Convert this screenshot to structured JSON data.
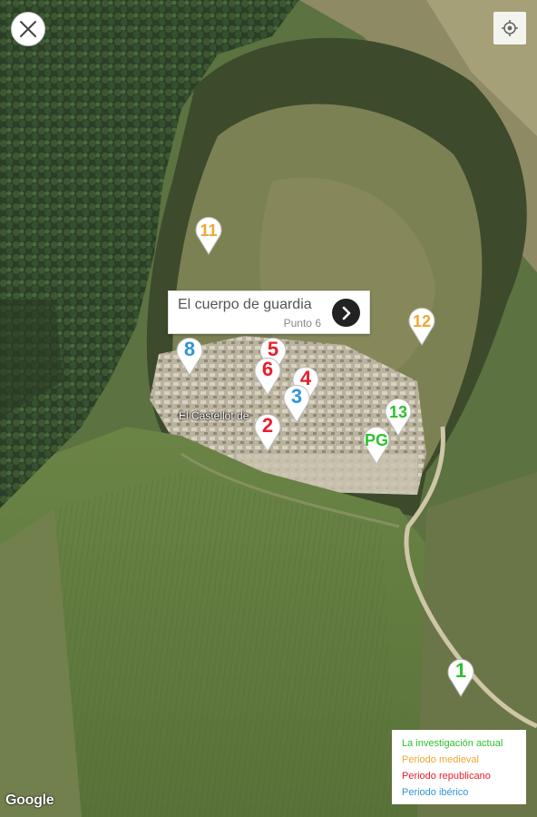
{
  "map": {
    "type": "satellite",
    "attribution": "Google",
    "site_label": "El Castellot de "
  },
  "controls": {
    "close_icon": "close-icon",
    "locate_icon": "locate-icon"
  },
  "callout": {
    "title": "El cuerpo de guardia",
    "subtitle": "Punto 6",
    "arrow_icon": "chevron-right-icon"
  },
  "colors": {
    "actual": "#2ec12e",
    "medieval": "#f2a733",
    "republicano": "#e8202a",
    "iberico": "#2f95d8"
  },
  "markers": [
    {
      "label": "11",
      "period": "medieval"
    },
    {
      "label": "12",
      "period": "medieval"
    },
    {
      "label": "8",
      "period": "iberico"
    },
    {
      "label": "5",
      "period": "republicano"
    },
    {
      "label": "6",
      "period": "republicano"
    },
    {
      "label": "4",
      "period": "republicano"
    },
    {
      "label": "3",
      "period": "iberico"
    },
    {
      "label": "2",
      "period": "republicano"
    },
    {
      "label": "13",
      "period": "actual"
    },
    {
      "label": "PG",
      "period": "actual"
    },
    {
      "label": "1",
      "period": "actual"
    }
  ],
  "legend": {
    "items": [
      {
        "label": "La investigación actual",
        "color": "#2ec12e"
      },
      {
        "label": "Periodo medieval",
        "color": "#f2a733"
      },
      {
        "label": "Periodo republicano",
        "color": "#e8202a"
      },
      {
        "label": "Periodo ibérico",
        "color": "#2f95d8"
      }
    ]
  }
}
